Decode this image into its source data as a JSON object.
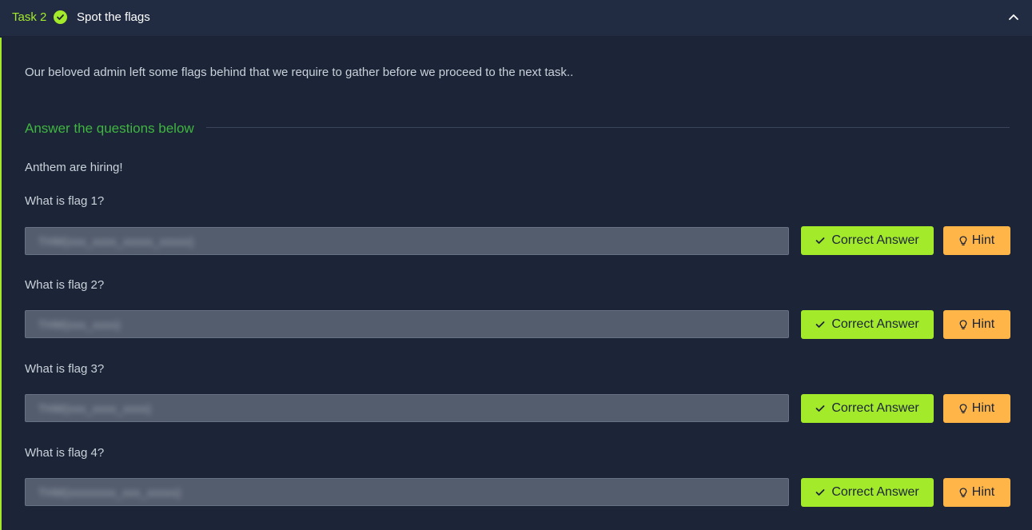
{
  "task": {
    "number_label": "Task 2",
    "title": "Spot the flags",
    "description": "Our beloved admin left some flags behind that we require to gather before we proceed to the next task..",
    "answer_heading": "Answer the questions below",
    "intro": "Anthem are hiring!"
  },
  "questions": [
    {
      "label": "What is flag 1?",
      "answer": "THM{xxx_xxxx_xxxxx_xxxxx}",
      "correct_label": "Correct Answer",
      "hint_label": "Hint"
    },
    {
      "label": "What is flag 2?",
      "answer": "THM{xxx_xxxx}",
      "correct_label": "Correct Answer",
      "hint_label": "Hint"
    },
    {
      "label": "What is flag 3?",
      "answer": "THM{xxx_xxxx_xxxx}",
      "correct_label": "Correct Answer",
      "hint_label": "Hint"
    },
    {
      "label": "What is flag 4?",
      "answer": "THM{xxxxxxxx_xxx_xxxxx}",
      "correct_label": "Correct Answer",
      "hint_label": "Hint"
    }
  ],
  "colors": {
    "accent": "#a3ea2a",
    "heading": "#3fb53f",
    "hint": "#ffb547",
    "background": "#1c2538"
  },
  "icons": {
    "status": "check-circle-icon",
    "collapse": "chevron-up-icon",
    "correct": "checkmark-icon",
    "hint": "lightbulb-icon"
  }
}
